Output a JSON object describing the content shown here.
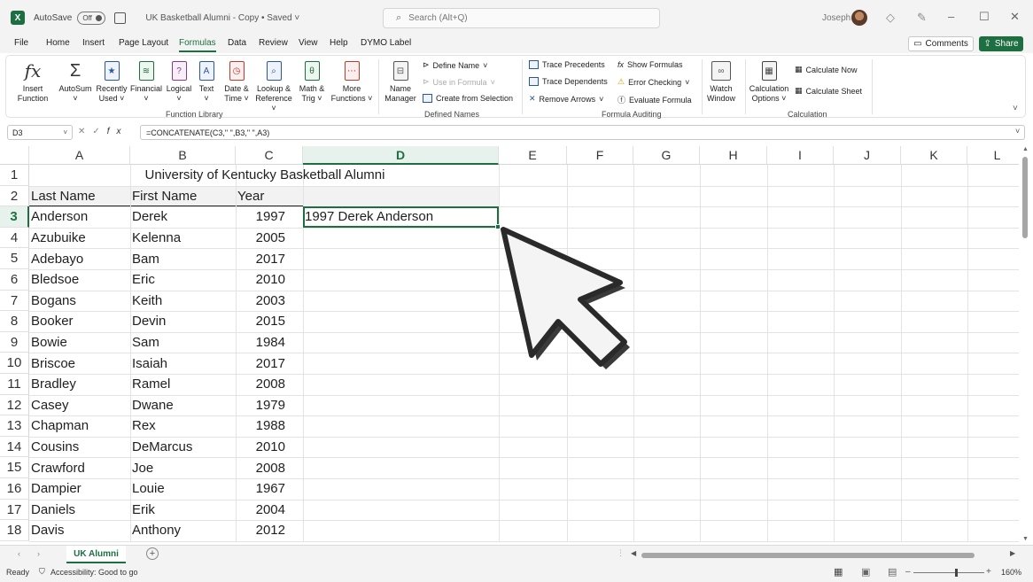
{
  "titlebar": {
    "autosave_label": "AutoSave",
    "autosave_state": "Off",
    "document_title": "UK Basketball Alumni - Copy • Saved ˅",
    "search_placeholder": "Search (Alt+Q)",
    "user_name": "Joseph"
  },
  "menu": {
    "tabs": [
      "File",
      "Home",
      "Insert",
      "Page Layout",
      "Formulas",
      "Data",
      "Review",
      "View",
      "Help",
      "DYMO Label"
    ],
    "active_tab": "Formulas",
    "comments_label": "Comments",
    "share_label": "Share"
  },
  "ribbon": {
    "function_library": {
      "label": "Function Library",
      "buttons": [
        {
          "line1": "Insert",
          "line2": "Function",
          "icon": "fx-icon"
        },
        {
          "line1": "AutoSum",
          "line2": "˅",
          "icon": "sigma-icon"
        },
        {
          "line1": "Recently",
          "line2": "Used ˅",
          "icon": "star-icon"
        },
        {
          "line1": "Financial",
          "line2": "˅",
          "icon": "stack-icon"
        },
        {
          "line1": "Logical",
          "line2": "˅",
          "icon": "question-icon"
        },
        {
          "line1": "Text",
          "line2": "˅",
          "icon": "text-a-icon"
        },
        {
          "line1": "Date &",
          "line2": "Time ˅",
          "icon": "clock-icon"
        },
        {
          "line1": "Lookup &",
          "line2": "Reference ˅",
          "icon": "magnifier-icon"
        },
        {
          "line1": "Math &",
          "line2": "Trig ˅",
          "icon": "theta-icon"
        },
        {
          "line1": "More",
          "line2": "Functions ˅",
          "icon": "dots-icon"
        }
      ]
    },
    "defined_names": {
      "label": "Defined Names",
      "name_manager": {
        "line1": "Name",
        "line2": "Manager"
      },
      "define_name": "Define Name",
      "use_in_formula": "Use in Formula",
      "create_from_selection": "Create from Selection"
    },
    "formula_auditing": {
      "label": "Formula Auditing",
      "trace_precedents": "Trace Precedents",
      "trace_dependents": "Trace Dependents",
      "remove_arrows": "Remove Arrows",
      "show_formulas": "Show Formulas",
      "error_checking": "Error Checking",
      "evaluate_formula": "Evaluate Formula",
      "watch_window": {
        "line1": "Watch",
        "line2": "Window"
      }
    },
    "calculation": {
      "label": "Calculation",
      "options": {
        "line1": "Calculation",
        "line2": "Options ˅"
      },
      "calculate_now": "Calculate Now",
      "calculate_sheet": "Calculate Sheet"
    }
  },
  "formula_bar": {
    "name_box": "D3",
    "formula": "=CONCATENATE(C3,\" \",B3,\" \",A3)"
  },
  "sheet": {
    "columns": [
      "A",
      "B",
      "C",
      "D",
      "E",
      "F",
      "G",
      "H",
      "I",
      "J",
      "K",
      "L"
    ],
    "title": "University of Kentucky Basketball Alumni",
    "headers": [
      "Last Name",
      "First Name",
      "Year"
    ],
    "rows": [
      [
        "Anderson",
        "Derek",
        "1997",
        "1997 Derek Anderson"
      ],
      [
        "Azubuike",
        "Kelenna",
        "2005",
        ""
      ],
      [
        "Adebayo",
        "Bam",
        "2017",
        ""
      ],
      [
        "Bledsoe",
        "Eric",
        "2010",
        ""
      ],
      [
        "Bogans",
        "Keith",
        "2003",
        ""
      ],
      [
        "Booker",
        "Devin",
        "2015",
        ""
      ],
      [
        "Bowie",
        "Sam",
        "1984",
        ""
      ],
      [
        "Briscoe",
        "Isaiah",
        "2017",
        ""
      ],
      [
        "Bradley",
        "Ramel",
        "2008",
        ""
      ],
      [
        "Casey",
        "Dwane",
        "1979",
        ""
      ],
      [
        "Chapman",
        "Rex",
        "1988",
        ""
      ],
      [
        "Cousins",
        "DeMarcus",
        "2010",
        ""
      ],
      [
        "Crawford",
        "Joe",
        "2008",
        ""
      ],
      [
        "Dampier",
        "Louie",
        "1967",
        ""
      ],
      [
        "Daniels",
        "Erik",
        "2004",
        ""
      ],
      [
        "Davis",
        "Anthony",
        "2012",
        ""
      ]
    ],
    "row_numbers": [
      "1",
      "2",
      "3",
      "4",
      "5",
      "6",
      "7",
      "8",
      "9",
      "10",
      "11",
      "12",
      "13",
      "14",
      "15",
      "16",
      "17",
      "18"
    ],
    "selected_cell": "D3",
    "accent_color": "#1d6f42"
  },
  "sheet_tabs": {
    "active": "UK Alumni",
    "add_label": "+"
  },
  "status": {
    "ready": "Ready",
    "accessibility": "Accessibility: Good to go",
    "zoom": "160%"
  }
}
